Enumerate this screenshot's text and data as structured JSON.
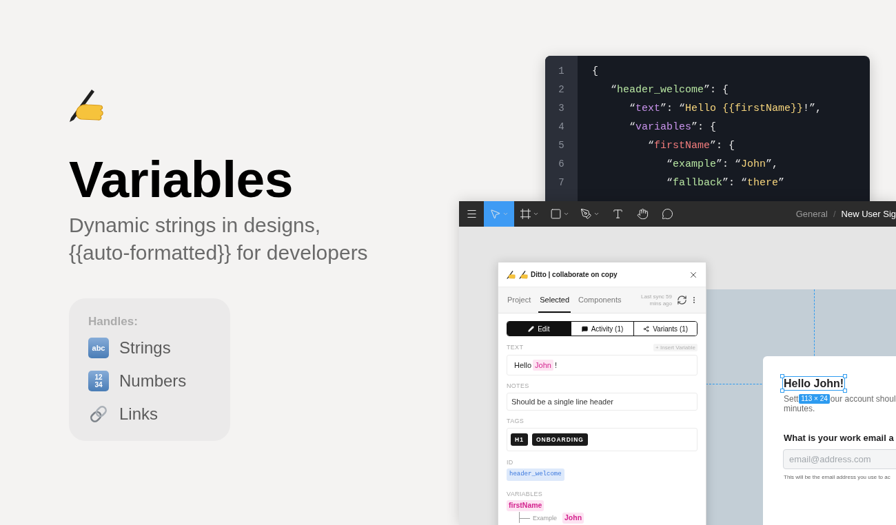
{
  "intro": {
    "title": "Variables",
    "subtitle_lines": [
      "Dynamic strings in designs,",
      "{{auto-formatted}} for developers"
    ]
  },
  "handles": {
    "heading": "Handles:",
    "items": [
      {
        "kind": "letters",
        "symbol": "abc",
        "label": "Strings"
      },
      {
        "kind": "numbers",
        "symbol": "1234",
        "label": "Numbers"
      },
      {
        "kind": "link",
        "label": "Links"
      }
    ]
  },
  "code_editor": {
    "line_numbers": [
      "1",
      "2",
      "3",
      "4",
      "5",
      "6",
      "7"
    ],
    "lines": [
      {
        "tokens": [
          {
            "text": "{",
            "color": "#e8e8e8"
          }
        ],
        "children": [
          {
            "tokens": [
              {
                "text": "“",
                "color": "#e8e8e8"
              },
              {
                "text": "header_welcome",
                "color": "#b5e3a0"
              },
              {
                "text": "”: {",
                "color": "#e8e8e8"
              }
            ],
            "children": [
              {
                "tokens": [
                  {
                    "text": "“",
                    "color": "#e8e8e8"
                  },
                  {
                    "text": "text",
                    "color": "#c792ea"
                  },
                  {
                    "text": "”: “",
                    "color": "#e8e8e8"
                  },
                  {
                    "text": "Hello {{firstName}}",
                    "color": "#f5d47c"
                  },
                  {
                    "text": "!”,",
                    "color": "#e8e8e8"
                  }
                ]
              },
              {
                "tokens": [
                  {
                    "text": "“",
                    "color": "#e8e8e8"
                  },
                  {
                    "text": "variables",
                    "color": "#c792ea"
                  },
                  {
                    "text": "”: {",
                    "color": "#e8e8e8"
                  }
                ],
                "children": [
                  {
                    "tokens": [
                      {
                        "text": "“",
                        "color": "#e8e8e8"
                      },
                      {
                        "text": "firstName",
                        "color": "#f27c7c"
                      },
                      {
                        "text": "”: {",
                        "color": "#e8e8e8"
                      }
                    ],
                    "children": [
                      {
                        "tokens": [
                          {
                            "text": "“",
                            "color": "#e8e8e8"
                          },
                          {
                            "text": "example",
                            "color": "#b5e3a0"
                          },
                          {
                            "text": "”: “",
                            "color": "#e8e8e8"
                          },
                          {
                            "text": "John",
                            "color": "#f5d47c"
                          },
                          {
                            "text": "”,",
                            "color": "#e8e8e8"
                          }
                        ]
                      },
                      {
                        "tokens": [
                          {
                            "text": "“",
                            "color": "#e8e8e8"
                          },
                          {
                            "text": "fallback",
                            "color": "#b5e3a0"
                          },
                          {
                            "text": "”: “",
                            "color": "#e8e8e8"
                          },
                          {
                            "text": "there",
                            "color": "#f5d47c"
                          },
                          {
                            "text": "”",
                            "color": "#e8e8e8"
                          }
                        ]
                      }
                    ]
                  }
                ]
              }
            ]
          }
        ]
      }
    ]
  },
  "design_app": {
    "toolbar": {
      "tools": [
        {
          "kind": "menu",
          "selected": false,
          "has_menu": false
        },
        {
          "kind": "move",
          "selected": true,
          "has_menu": true
        },
        {
          "kind": "frame",
          "selected": false,
          "has_menu": true
        },
        {
          "kind": "shape",
          "selected": false,
          "has_menu": true
        },
        {
          "kind": "pen",
          "selected": false,
          "has_menu": true
        },
        {
          "kind": "text",
          "selected": false,
          "has_menu": false
        },
        {
          "kind": "hand",
          "selected": false,
          "has_menu": false
        },
        {
          "kind": "comment",
          "selected": false,
          "has_menu": false
        }
      ],
      "breadcrumb": {
        "parent": "General",
        "separator": "/",
        "current": "New User Sig"
      }
    },
    "plugin": {
      "title": "Ditto | collaborate on copy",
      "tabs": [
        {
          "label": "Project",
          "selected": false
        },
        {
          "label": "Selected",
          "selected": true
        },
        {
          "label": "Components",
          "selected": false
        }
      ],
      "sync_status": "Last sync 59 mins ago",
      "modes": [
        {
          "kind": "edit",
          "label": "Edit",
          "selected": true
        },
        {
          "kind": "activity",
          "label": "Activity (1)",
          "selected": false
        },
        {
          "kind": "variants",
          "label": "Variants (1)",
          "selected": false
        }
      ],
      "text_field": {
        "label": "TEXT",
        "insert_button": "+ Insert Variable",
        "parts": [
          {
            "kind": "text",
            "text": "Hello"
          },
          {
            "kind": "variable",
            "text": "John"
          },
          {
            "kind": "text",
            "text": "!"
          }
        ]
      },
      "notes": {
        "label": "NOTES",
        "value": "Should be a single line header"
      },
      "tags": {
        "label": "TAGS",
        "items": [
          "H1",
          "ONBOARDING"
        ]
      },
      "id": {
        "label": "ID",
        "value": "header_welcome"
      },
      "variables": {
        "label": "VARIABLES",
        "items": [
          {
            "name": "firstName",
            "children": [
              {
                "label": "Example",
                "value": "John"
              }
            ]
          }
        ]
      }
    },
    "canvas": {
      "selected_text": "Hello John!",
      "selection_size": "113 × 24",
      "card": {
        "description_fragments": [
          "Sett",
          "our account shoul",
          "minutes."
        ],
        "question": "What is your work email a",
        "email_placeholder": "email@address.com",
        "helper": "This will be the email address you use to ac"
      }
    }
  }
}
